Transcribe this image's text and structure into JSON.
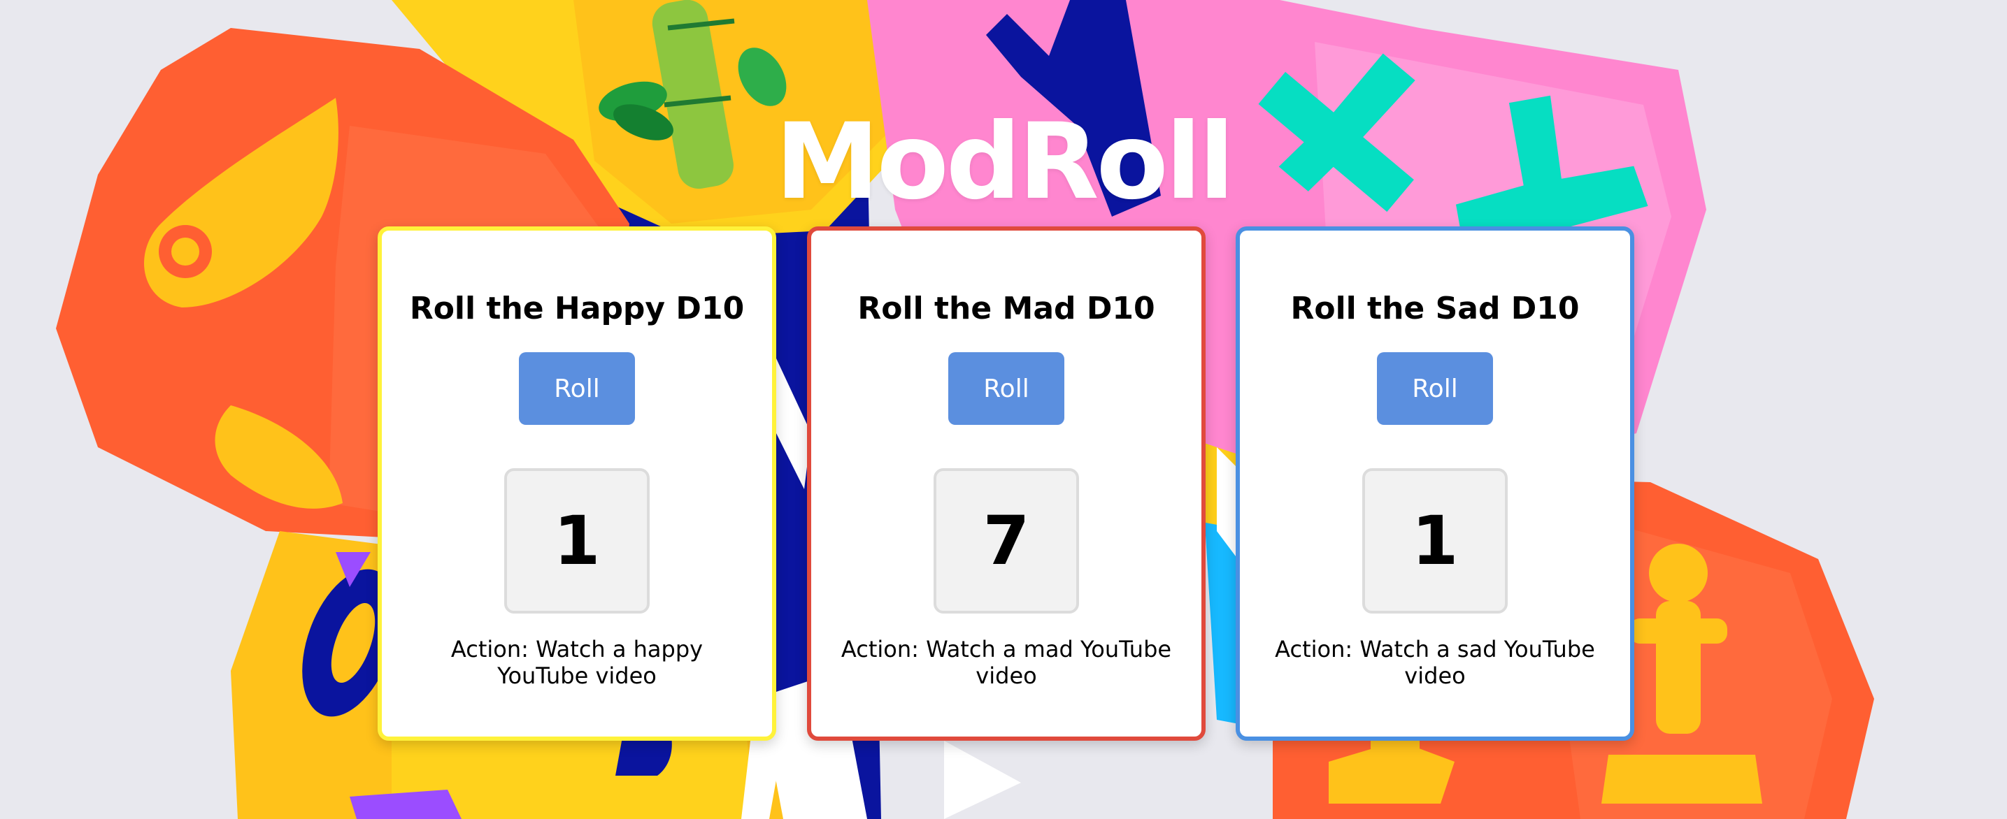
{
  "app": {
    "title": "ModRoll"
  },
  "background": {
    "icons": [
      "wing-icon",
      "bamboo-icon",
      "sword-icon",
      "cross-icon",
      "chess-pawn-icon",
      "play-icon"
    ],
    "colors": {
      "orange": "#ff6a3a",
      "yellow": "#ffcf1a",
      "pink": "#ff86cf",
      "navy": "#0a149e",
      "teal": "#06dec2",
      "sky": "#17b9ff"
    }
  },
  "cards": [
    {
      "title": "Roll the Happy D10",
      "button_label": "Roll",
      "result": "1",
      "action": "Action: Watch a happy YouTube video",
      "border_color": "#fff23a"
    },
    {
      "title": "Roll the Mad D10",
      "button_label": "Roll",
      "result": "7",
      "action": "Action: Watch a mad YouTube video",
      "border_color": "#e04a3c"
    },
    {
      "title": "Roll the Sad D10",
      "button_label": "Roll",
      "result": "1",
      "action": "Action: Watch a sad YouTube video",
      "border_color": "#4a90e2"
    }
  ]
}
